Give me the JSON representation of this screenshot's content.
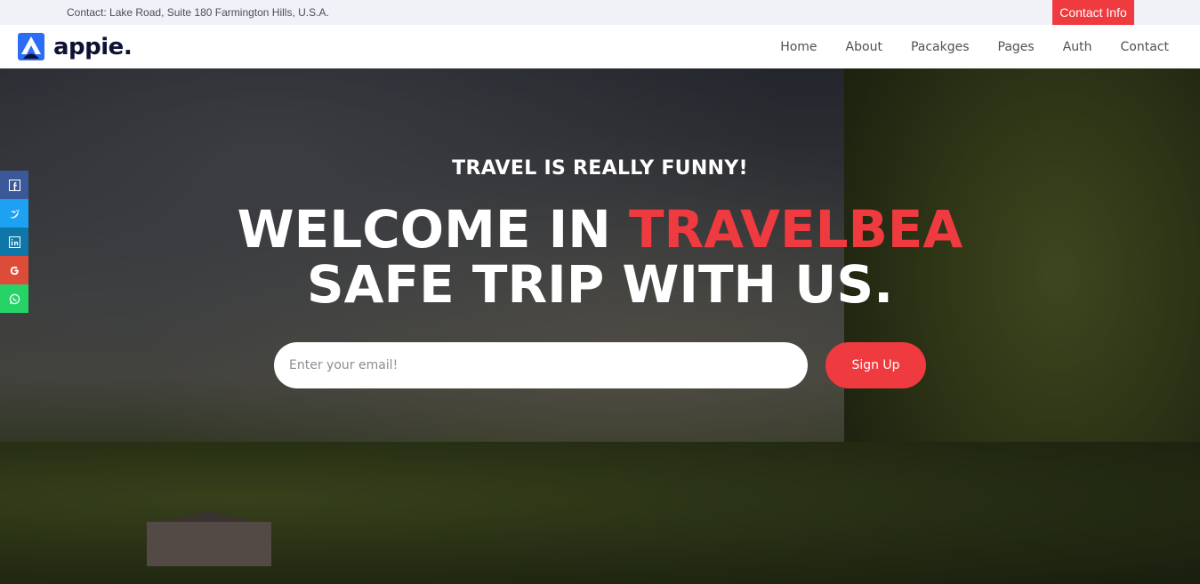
{
  "topbar": {
    "contact_text": "Contact: Lake Road, Suite 180 Farmington Hills, U.S.A.",
    "contact_button": "Contact Info",
    "accent_color": "#ef3b3f"
  },
  "brand": {
    "name": "appie.",
    "logo_icon": "appie-logo-icon",
    "color": "#2b6df5"
  },
  "nav": {
    "items": [
      {
        "label": "Home"
      },
      {
        "label": "About"
      },
      {
        "label": "Pacakges"
      },
      {
        "label": "Pages"
      },
      {
        "label": "Auth"
      },
      {
        "label": "Contact"
      }
    ]
  },
  "hero": {
    "subtitle": "TRAVEL IS REALLY FUNNY!",
    "title_line1_prefix": "WELCOME IN ",
    "title_line1_accent": "TRAVELBEA",
    "title_line2": "SAFE TRIP WITH US.",
    "email_placeholder": "Enter your email!",
    "signup_label": "Sign Up"
  },
  "social": [
    {
      "icon": "facebook-icon",
      "color": "#3b5998"
    },
    {
      "icon": "twitter-icon",
      "color": "#1da1f2"
    },
    {
      "icon": "linkedin-icon",
      "color": "#0e76a8"
    },
    {
      "icon": "google-icon",
      "color": "#dd4b39"
    },
    {
      "icon": "whatsapp-icon",
      "color": "#25d366"
    }
  ]
}
